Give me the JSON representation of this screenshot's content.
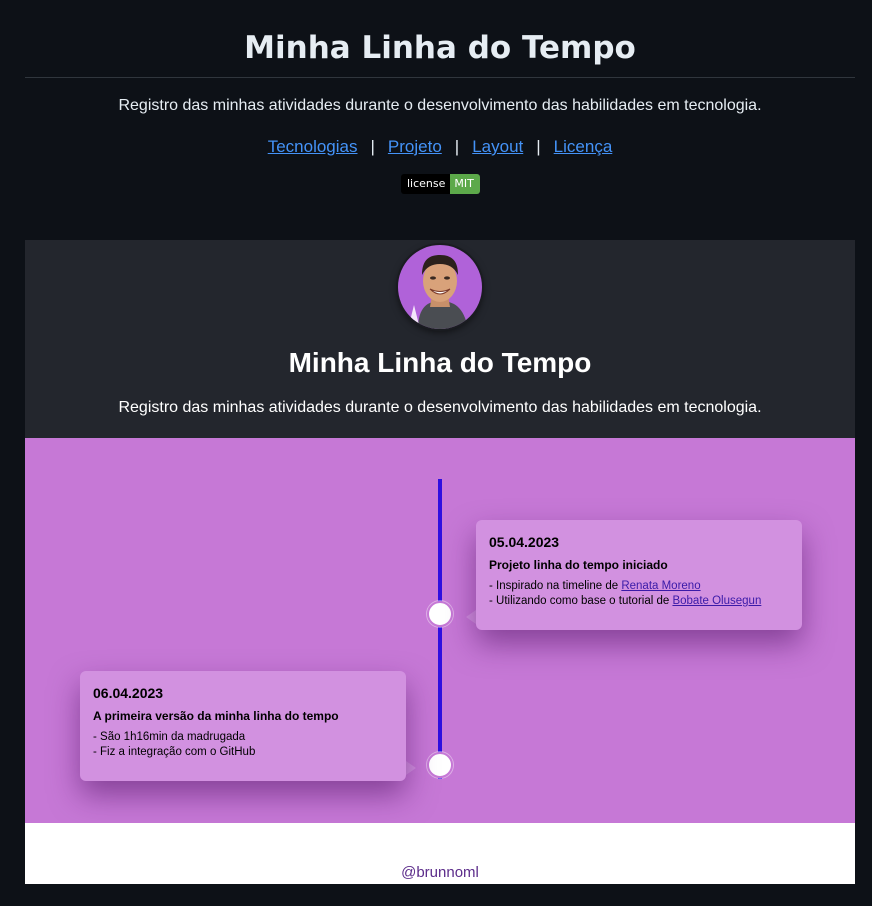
{
  "readme": {
    "title": "Minha Linha do Tempo",
    "description": "Registro das minhas atividades durante o desenvolvimento das habilidades em tecnologia.",
    "nav": {
      "links": [
        "Tecnologias",
        "Projeto",
        "Layout",
        "Licença"
      ],
      "separator": "|"
    },
    "badge": {
      "label": "license",
      "value": "MIT"
    }
  },
  "preview": {
    "header": {
      "title": "Minha Linha do Tempo",
      "description": "Registro das minhas atividades durante o desenvolvimento das habilidades em tecnologia."
    },
    "timeline": [
      {
        "date": "05.04.2023",
        "heading": "Projeto linha do tempo iniciado",
        "items": [
          {
            "prefix": "- Inspirado na timeline de ",
            "link": "Renata Moreno"
          },
          {
            "prefix": "- Utilizando como base o tutorial de ",
            "link": "Bobate Olusegun"
          }
        ]
      },
      {
        "date": "06.04.2023",
        "heading": "A primeira versão da minha linha do tempo",
        "items": [
          {
            "prefix": "- São 1h16min da madrugada",
            "link": ""
          },
          {
            "prefix": "- Fiz a integração com o GitHub",
            "link": ""
          }
        ]
      }
    ],
    "footer": {
      "handle": "@brunnoml"
    }
  },
  "colors": {
    "page_bg": "#0d1117",
    "link": "#4493f8",
    "preview_header_bg": "#23262d",
    "timeline_bg": "#c678d6",
    "card_bg": "#d291e0",
    "timeline_line": "#2e0fe0",
    "badge_green": "#5ca94a"
  }
}
